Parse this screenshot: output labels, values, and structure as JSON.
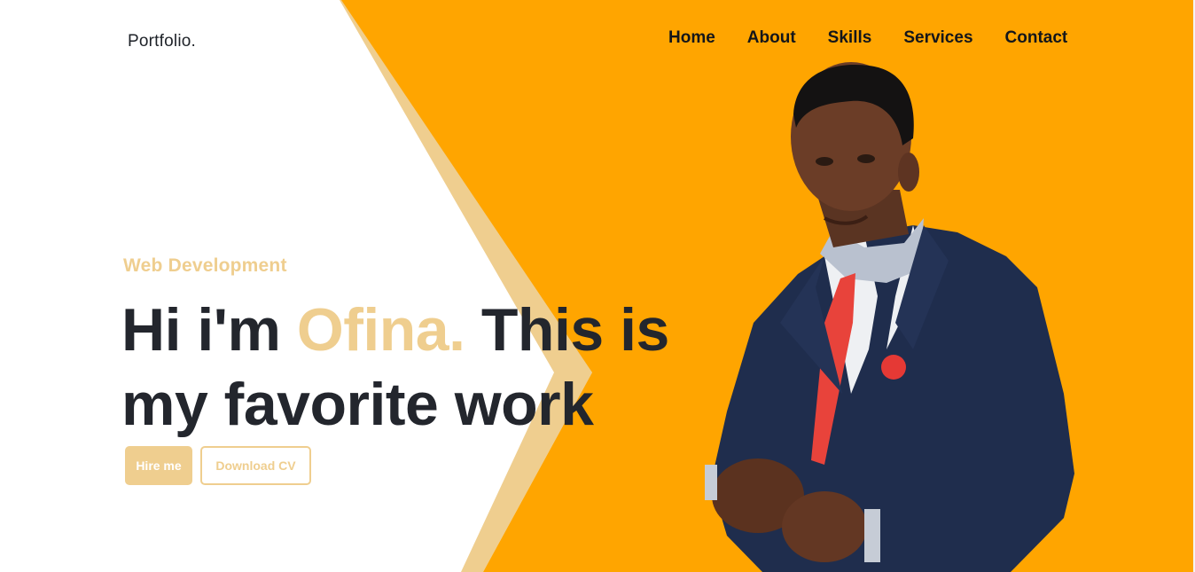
{
  "brand": {
    "logo": "Portfolio."
  },
  "nav": {
    "items": [
      "Home",
      "About",
      "Skills",
      "Services",
      "Contact"
    ]
  },
  "hero": {
    "subtitle": "Web Development",
    "headline_part1": "Hi i'm ",
    "headline_name": "Ofina.",
    "headline_part2": " This is my favorite work",
    "hire_button": "Hire me",
    "cv_button": "Download CV"
  },
  "colors": {
    "primary": "#ffa500",
    "accent": "#efce8f",
    "text_dark": "#23262d",
    "background": "#ffffff"
  },
  "icons": [
    "person-portrait-photo"
  ]
}
